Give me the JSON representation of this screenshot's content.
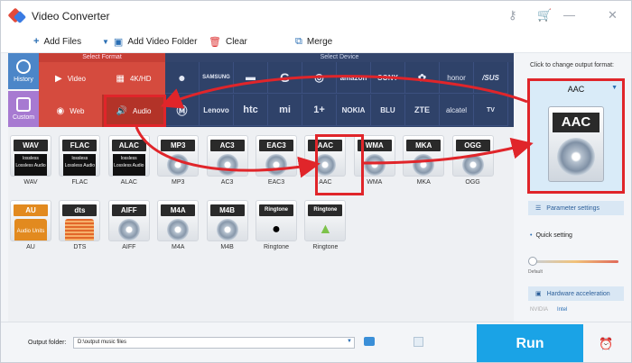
{
  "titlebar": {
    "title": "Video Converter"
  },
  "toolbar": {
    "add_files": "Add Files",
    "add_video_folder": "Add Video Folder",
    "clear": "Clear",
    "merge": "Merge"
  },
  "side": {
    "history": "History",
    "custom": "Custom"
  },
  "headers": {
    "select_format": "Select Format",
    "select_device": "Select Device"
  },
  "format_types": [
    {
      "label": "Video"
    },
    {
      "label": "4K/HD"
    },
    {
      "label": "Web"
    },
    {
      "label": "Audio"
    }
  ],
  "devices_row1": [
    "",
    "SAMSUNG",
    "",
    "G",
    "",
    "amazon",
    "SONY",
    "",
    "honor",
    "/SUS"
  ],
  "devices_row2": [
    "",
    "Lenovo",
    "htc",
    "mi",
    "1+",
    "NOKIA",
    "BLU",
    "ZTE",
    "alcatel",
    "TV"
  ],
  "audio_formats_row1": [
    {
      "badge": "WAV",
      "name": "WAV",
      "kind": "lossless"
    },
    {
      "badge": "FLAC",
      "name": "FLAC",
      "kind": "lossless"
    },
    {
      "badge": "ALAC",
      "name": "ALAC",
      "kind": "lossless"
    },
    {
      "badge": "MP3",
      "name": "MP3",
      "kind": "disc"
    },
    {
      "badge": "AC3",
      "name": "AC3",
      "kind": "disc"
    },
    {
      "badge": "EAC3",
      "name": "EAC3",
      "kind": "disc"
    },
    {
      "badge": "AAC",
      "name": "AAC",
      "kind": "disc"
    },
    {
      "badge": "WMA",
      "name": "WMA",
      "kind": "disc"
    },
    {
      "badge": "MKA",
      "name": "MKA",
      "kind": "disc"
    },
    {
      "badge": "OGG",
      "name": "OGG",
      "kind": "disc"
    }
  ],
  "audio_formats_row2": [
    {
      "badge": "AU",
      "name": "AU",
      "kind": "au"
    },
    {
      "badge": "dts",
      "name": "DTS",
      "kind": "dts"
    },
    {
      "badge": "AIFF",
      "name": "AIFF",
      "kind": "disc"
    },
    {
      "badge": "M4A",
      "name": "M4A",
      "kind": "disc"
    },
    {
      "badge": "M4B",
      "name": "M4B",
      "kind": "disc"
    },
    {
      "badge": "Ringtone",
      "name": "Ringtone",
      "kind": "apple"
    },
    {
      "badge": "Ringtone",
      "name": "Ringtone",
      "kind": "android"
    }
  ],
  "lossless_text": "lossless Lossless Audio",
  "au_text": "Audio Units",
  "right_panel": {
    "caption": "Click to change output format:",
    "selected_format": "AAC",
    "icon_badge": "AAC",
    "parameter_settings": "Parameter settings",
    "quick_setting": "Quick setting",
    "default_label": "Default",
    "hardware_acceleration": "Hardware acceleration",
    "gpu_nvidia": "NVIDIA",
    "gpu_intel": "Intel"
  },
  "bottom": {
    "output_folder_label": "Output folder:",
    "output_folder_value": "D:\\output music files",
    "run": "Run"
  },
  "colors": {
    "accent_red": "#e0252a",
    "format_header": "#c73f35",
    "device_header": "#33456c",
    "run_button": "#1aa3e6"
  }
}
